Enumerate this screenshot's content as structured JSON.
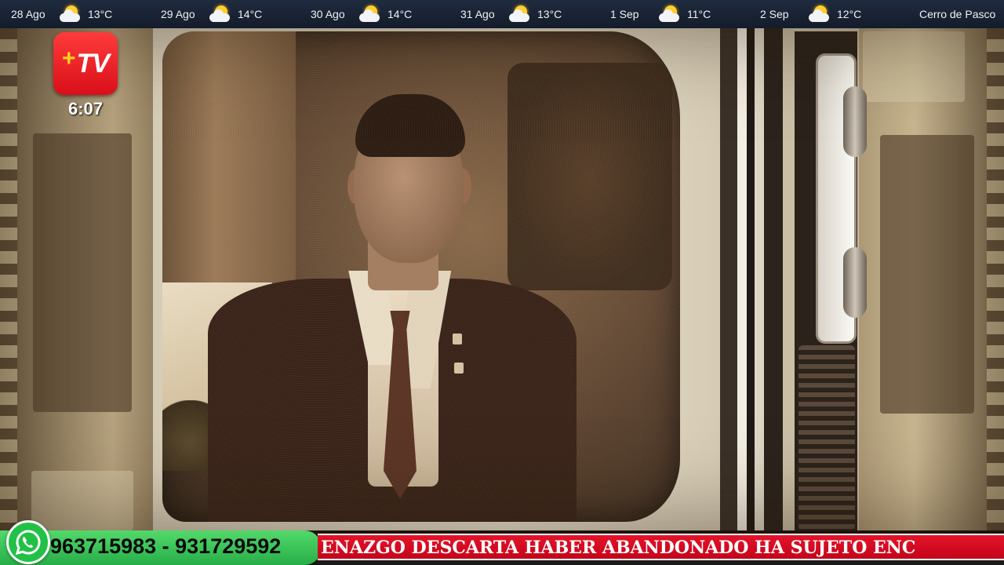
{
  "weather": {
    "days": [
      {
        "date": "28 Ago",
        "icon": "partly-cloudy-icon",
        "temp": "13°C"
      },
      {
        "date": "29 Ago",
        "icon": "partly-cloudy-icon",
        "temp": "14°C"
      },
      {
        "date": "30 Ago",
        "icon": "partly-cloudy-icon",
        "temp": "14°C"
      },
      {
        "date": "31 Ago",
        "icon": "partly-cloudy-icon",
        "temp": "13°C"
      },
      {
        "date": "1 Sep",
        "icon": "partly-cloudy-icon",
        "temp": "11°C"
      },
      {
        "date": "2 Sep",
        "icon": "partly-cloudy-icon",
        "temp": "12°C"
      }
    ],
    "location": "Cerro de Pasco"
  },
  "channel": {
    "logo_plus": "+",
    "logo_text": "TV",
    "time": "6:07",
    "colors": {
      "logo_red": "#e11d24",
      "logo_yellow": "#ffd21f"
    }
  },
  "contact": {
    "icon": "whatsapp-icon",
    "phones": "963715983 - 931729592",
    "color": "#2fbf4f"
  },
  "ticker": {
    "text": "ENAZGO DESCARTA HABER ABANDONADO HA SUJETO ENC",
    "color": "#d60a1f"
  }
}
